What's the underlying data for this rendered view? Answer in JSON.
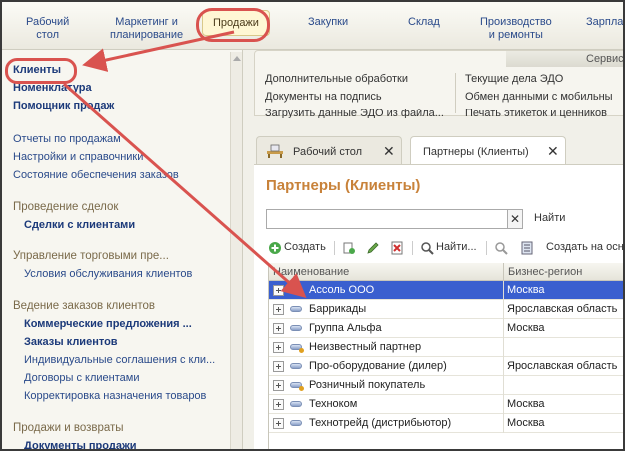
{
  "topnav": {
    "items": [
      {
        "label": "Рабочий\nстол"
      },
      {
        "label": "Маркетинг и\nпланирование"
      },
      {
        "label": "Продажи"
      },
      {
        "label": "Закупки"
      },
      {
        "label": "Склад"
      },
      {
        "label": "Производство\nи ремонты"
      },
      {
        "label": "Зарпла"
      }
    ]
  },
  "sidebar": {
    "items": [
      {
        "label": "Клиенты"
      },
      {
        "label": "Номенклатура"
      },
      {
        "label": "Помощник продаж"
      },
      {
        "label": "Отчеты по продажам"
      },
      {
        "label": "Настройки и справочники"
      },
      {
        "label": "Состояние обеспечения заказов"
      },
      {
        "label": "Проведение сделок"
      },
      {
        "label": "Сделки с клиентами"
      },
      {
        "label": "Управление торговыми пре..."
      },
      {
        "label": "Условия обслуживания клиентов"
      },
      {
        "label": "Ведение заказов клиентов"
      },
      {
        "label": "Коммерческие предложения ..."
      },
      {
        "label": "Заказы клиентов"
      },
      {
        "label": "Индивидуальные соглашения с кли..."
      },
      {
        "label": "Договоры с клиентами"
      },
      {
        "label": "Корректировка назначения товаров"
      },
      {
        "label": "Продажи и возвраты"
      },
      {
        "label": "Документы продажи"
      }
    ]
  },
  "service": {
    "header": "Сервис",
    "left": [
      "Дополнительные обработки",
      "Документы на подпись",
      "Загрузить данные ЭДО из файла..."
    ],
    "right": [
      "Текущие дела ЭДО",
      "Обмен данными с мобильны",
      "Печать этикеток и ценников"
    ]
  },
  "tabs": [
    {
      "label": "Рабочий стол",
      "close": "✕"
    },
    {
      "label": "Партнеры (Клиенты)",
      "close": "✕"
    }
  ],
  "content": {
    "title": "Партнеры (Клиенты)",
    "search_value": "",
    "clear": "✕",
    "find_label": "Найти"
  },
  "toolbar": {
    "create": "Создать",
    "find": "Найти...",
    "create_based": "Создать на осн"
  },
  "table": {
    "columns": [
      "Наименование",
      "Бизнес-регион"
    ],
    "rows": [
      {
        "name": "Ассоль ООО",
        "region": "Москва",
        "selected": true
      },
      {
        "name": "Баррикады",
        "region": "Ярославская область"
      },
      {
        "name": "Группа Альфа",
        "region": "Москва"
      },
      {
        "name": "Неизвестный партнер",
        "region": ""
      },
      {
        "name": "Про-оборудование (дилер)",
        "region": "Ярославская область"
      },
      {
        "name": "Розничный покупатель",
        "region": ""
      },
      {
        "name": "Техноком",
        "region": "Москва"
      },
      {
        "name": "Технотрейд (дистрибьютор)",
        "region": "Москва"
      }
    ]
  },
  "colors": {
    "accent_orange": "#c8823a",
    "link_blue": "#2a4a8a",
    "selection": "#3a5fcf",
    "annotation_red": "#d9534f"
  }
}
